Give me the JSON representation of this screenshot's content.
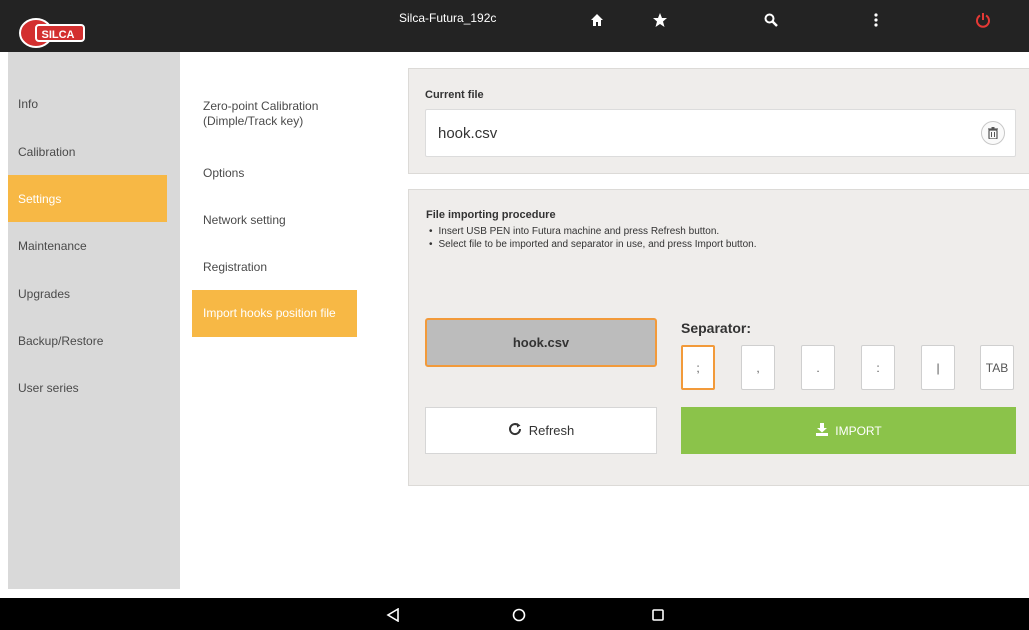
{
  "topbar": {
    "device_name": "Silca-Futura_192c",
    "icons": [
      "home-icon",
      "star-icon",
      "search-icon",
      "more-vertical-icon",
      "power-icon"
    ],
    "logo_text": "SILCA",
    "power_color": "#e53935"
  },
  "sidebar": {
    "items": [
      {
        "label": "Info"
      },
      {
        "label": "Calibration"
      },
      {
        "label": "Settings"
      },
      {
        "label": "Maintenance"
      },
      {
        "label": "Upgrades"
      },
      {
        "label": "Backup/Restore"
      },
      {
        "label": "User series"
      }
    ],
    "active": "Settings"
  },
  "submenu": {
    "items": [
      {
        "label": "Zero-point Calibration (Dimple/Track key)"
      },
      {
        "label": "Options"
      },
      {
        "label": "Network setting"
      },
      {
        "label": "Registration"
      },
      {
        "label": "Import hooks position file"
      }
    ],
    "active": "Import hooks position file"
  },
  "current_file": {
    "title": "Current file",
    "value": "hook.csv"
  },
  "import_panel": {
    "title": "File importing procedure",
    "steps": [
      "Insert USB PEN into Futura machine and press Refresh button.",
      "Select file to be imported and separator in use, and press Import button."
    ],
    "selected_file": "hook.csv",
    "separator_label": "Separator:",
    "separators": [
      ";",
      ",",
      ".",
      ":",
      "|",
      "TAB"
    ],
    "selected_separator": ";",
    "refresh_label": "Refresh",
    "import_label": "IMPORT"
  },
  "colors": {
    "accent": "#f7b845",
    "import_green": "#8bc34a",
    "selected_border": "#f29a3a"
  }
}
